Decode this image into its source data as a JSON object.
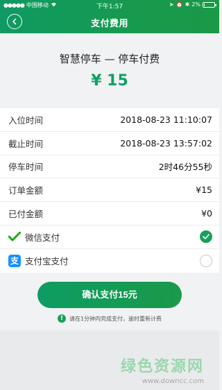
{
  "status_bar": {
    "carrier": "中国移动",
    "time": "下午1:57",
    "battery": "2%",
    "battery_level": 0.02
  },
  "nav": {
    "title": "支付费用",
    "back_icon": "back-arrow-icon"
  },
  "summary": {
    "title": "智慧停车 — 停车付费",
    "amount": "¥ 15"
  },
  "details": [
    {
      "label": "入位时间",
      "value": "2018-08-23 11:10:07"
    },
    {
      "label": "截止时间",
      "value": "2018-08-23 13:57:02"
    },
    {
      "label": "停车时间",
      "value": "2时46分55秒"
    },
    {
      "label": "订单金额",
      "value": "¥15"
    },
    {
      "label": "已付金额",
      "value": "¥0"
    }
  ],
  "payment_methods": [
    {
      "label": "微信支付",
      "icon": "wechat-pay-icon",
      "selected": true
    },
    {
      "label": "支付宝支付",
      "icon": "alipay-icon",
      "selected": false
    }
  ],
  "confirm_button": "确认支付15元",
  "notice": "请在1分钟内完成支付，逾时重新计费",
  "watermark": {
    "title": "绿色资源网",
    "url": "www.downcc.com"
  },
  "colors": {
    "brand_green": "#0ea262",
    "nav_gradient_start": "#0f9a63",
    "nav_gradient_end": "#1a9946",
    "alipay_blue": "#1690ff"
  }
}
